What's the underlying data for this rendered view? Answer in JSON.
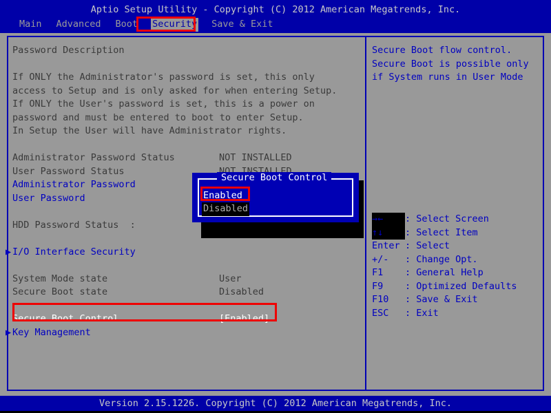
{
  "header": {
    "title": "Aptio Setup Utility - Copyright (C) 2012 American Megatrends, Inc.",
    "tabs": [
      {
        "label": "Main",
        "selected": false
      },
      {
        "label": "Advanced",
        "selected": false
      },
      {
        "label": "Boot",
        "selected": false
      },
      {
        "label": "Security",
        "selected": true
      },
      {
        "label": "Save & Exit",
        "selected": false
      }
    ]
  },
  "main": {
    "section_title": "Password Description",
    "description": [
      "If ONLY the Administrator's password is set, this only",
      "access to Setup and is only asked for when entering Setup.",
      "If ONLY the User's password is set, this is a power on",
      "password and must be entered to boot to enter Setup.",
      "In Setup the User will have Administrator rights."
    ],
    "items": [
      {
        "label": "Administrator Password Status",
        "value": "NOT INSTALLED",
        "style": "static",
        "arrow": false
      },
      {
        "label": "User Password Status",
        "value": "NOT INSTALLED",
        "style": "static",
        "arrow": false
      },
      {
        "label": "Administrator Password",
        "value": "",
        "style": "link",
        "arrow": false
      },
      {
        "label": "User Password",
        "value": "",
        "style": "link",
        "arrow": false
      },
      {
        "label": "",
        "value": "",
        "style": "blank",
        "arrow": false
      },
      {
        "label": "HDD Password Status  :",
        "value": "",
        "style": "static",
        "arrow": false
      },
      {
        "label": "",
        "value": "",
        "style": "blank",
        "arrow": false
      },
      {
        "label": "I/O Interface Security",
        "value": "",
        "style": "link",
        "arrow": true
      },
      {
        "label": "",
        "value": "",
        "style": "blank",
        "arrow": false
      },
      {
        "label": "System Mode state",
        "value": "User",
        "style": "static",
        "arrow": false
      },
      {
        "label": "Secure Boot state",
        "value": "Disabled",
        "style": "static",
        "arrow": false
      },
      {
        "label": "",
        "value": "",
        "style": "blank",
        "arrow": false
      },
      {
        "label": "Secure Boot Control",
        "value": "[Enabled]",
        "style": "highlighted",
        "arrow": false
      },
      {
        "label": "Key Management",
        "value": "",
        "style": "link",
        "arrow": true
      }
    ]
  },
  "help": {
    "lines": [
      "Secure Boot flow control.",
      "Secure Boot is possible only",
      "if System runs in User Mode"
    ],
    "legend": [
      {
        "key": "→←",
        "icon_name": "left-right-arrow-icon",
        "desc": ": Select Screen",
        "shadowed": true
      },
      {
        "key": "↑↓",
        "icon_name": "up-down-arrow-icon",
        "desc": ": Select Item",
        "shadowed": true
      },
      {
        "key": "Enter",
        "icon_name": "",
        "desc": ": Select",
        "shadowed": false
      },
      {
        "key": "+/-",
        "icon_name": "",
        "desc": ": Change Opt.",
        "shadowed": false
      },
      {
        "key": "F1",
        "icon_name": "",
        "desc": ": General Help",
        "shadowed": false
      },
      {
        "key": "F9",
        "icon_name": "",
        "desc": ": Optimized Defaults",
        "shadowed": false
      },
      {
        "key": "F10",
        "icon_name": "",
        "desc": ": Save & Exit",
        "shadowed": false
      },
      {
        "key": "ESC",
        "icon_name": "",
        "desc": ": Exit",
        "shadowed": false
      }
    ]
  },
  "dialog": {
    "title": "Secure Boot Control",
    "options": [
      {
        "label": "Enabled",
        "selected": true
      },
      {
        "label": "Disabled",
        "selected": false
      }
    ]
  },
  "annotations": [
    {
      "name": "security-tab-annotation",
      "color": "#EE0000"
    },
    {
      "name": "enabled-option-annotation",
      "color": "#EE0000"
    },
    {
      "name": "secure-boot-control-annotation",
      "color": "#EE0000"
    }
  ],
  "footer": {
    "version": "Version 2.15.1226. Copyright (C) 2012 American Megatrends, Inc."
  },
  "colors": {
    "background": "#999999",
    "banner_blue": "#0000A8",
    "border_blue": "#0000B4",
    "text_blue": "#0000C0",
    "text_gray": "#3A3A3A",
    "banner_text": "#C8C8C8",
    "annotation_red": "#EE0000",
    "dialog_blue": "#0000B4",
    "shadow_black": "#000000"
  }
}
